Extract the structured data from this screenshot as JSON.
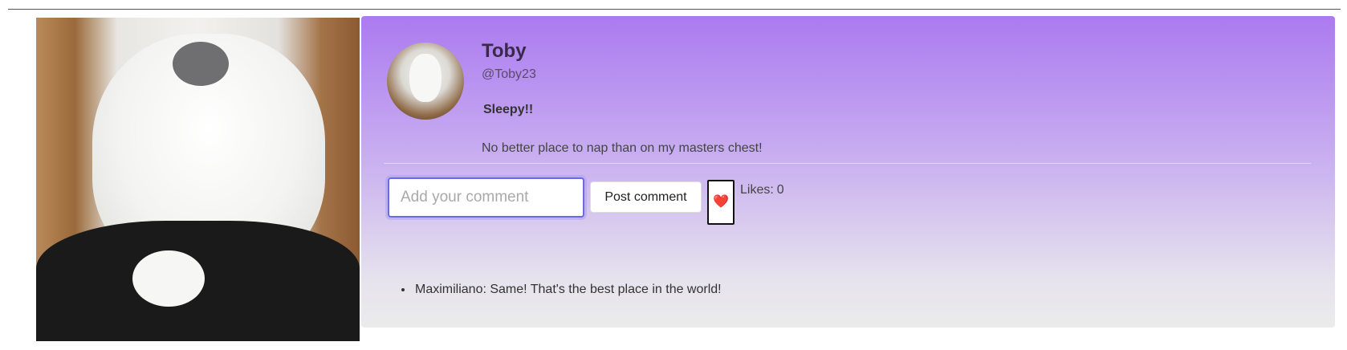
{
  "post": {
    "user": {
      "name": "Toby",
      "handle": "@Toby23"
    },
    "title": "Sleepy!!",
    "body": "No better place to nap than on my masters chest!",
    "comment_input": {
      "placeholder": "Add your comment",
      "value": ""
    },
    "post_comment_label": "Post comment",
    "like_icon": "heart-icon",
    "like_glyph": "❤️",
    "likes_label": "Likes:",
    "likes_count": "0",
    "comments": [
      {
        "author": "Maximiliano",
        "text": "Same! That's the best place in the world!"
      }
    ]
  },
  "colors": {
    "card_gradient_top": "#ab7af0",
    "card_gradient_bottom": "#ebebeb",
    "input_focus": "#6a6ae8",
    "heart": "#e0203a"
  }
}
